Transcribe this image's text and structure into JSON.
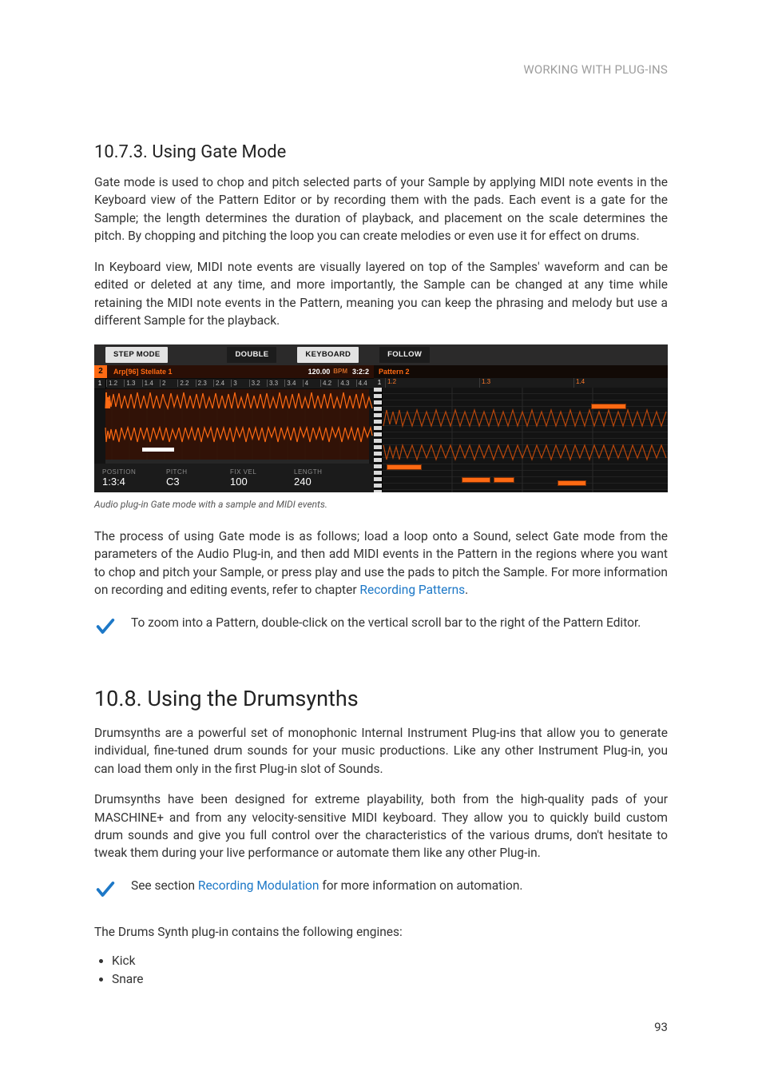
{
  "header": {
    "running_title": "WORKING WITH PLUG-INS"
  },
  "section1": {
    "heading": "10.7.3. Using Gate Mode",
    "p1": "Gate mode is used to chop and pitch selected parts of your Sample by applying MIDI note events in the Keyboard view of the Pattern Editor or by recording them with the pads. Each event is a gate for the Sample; the length determines the duration of playback, and placement on the scale determines the pitch. By chopping and pitching the loop you can create melodies or even use it for effect on drums.",
    "p2": "In Keyboard view, MIDI note events are visually layered on top of the Samples' waveform and can be edited or deleted at any time, and more importantly, the Sample can be changed at any time while retaining the MIDI note events in the Pattern, meaning you can keep the phrasing and melody but use a different Sample for the playback."
  },
  "figure": {
    "toolbar": {
      "step_mode": "STEP MODE",
      "double": "DOUBLE",
      "keyboard": "KEYBOARD",
      "follow": "FOLLOW"
    },
    "left": {
      "sound_index": "2",
      "sound_name": "Arp[96] Stellate 1",
      "bpm_value": "120.00",
      "bpm_unit": "BPM",
      "timesig": "3:2:2",
      "ruler_start_num": "1",
      "ruler_ticks": [
        "1.2",
        "1.3",
        "1.4",
        "2",
        "2.2",
        "2.3",
        "2.4",
        "3",
        "3.2",
        "3.3",
        "3.4",
        "4",
        "4.2",
        "4.3",
        "4.4"
      ],
      "params": {
        "position": {
          "label": "POSITION",
          "value": "1:3:4"
        },
        "pitch": {
          "label": "PITCH",
          "value": "C3"
        },
        "fixvel": {
          "label": "FIX VEL",
          "value": "100"
        },
        "length": {
          "label": "LENGTH",
          "value": "240"
        }
      }
    },
    "right": {
      "pattern_label": "Pattern 2",
      "ruler_start_num": "1",
      "ruler_ticks": [
        "1.2",
        "1.3",
        "1.4"
      ]
    },
    "caption": "Audio plug-in Gate mode with a sample and MIDI events."
  },
  "section1b": {
    "p3_pre": "The process of using Gate mode is as follows; load a loop onto a Sound, select Gate mode from the parameters of the Audio Plug-in, and then add MIDI events in the Pattern in the regions where you want to chop and pitch your Sample, or press play and use the pads to pitch the Sample. For more information on recording and editing events, refer to chapter ",
    "p3_link": "Recording Patterns",
    "p3_post": ".",
    "tip": "To zoom into a Pattern, double-click on the vertical scroll bar to the right of the Pattern Editor."
  },
  "section2": {
    "heading": "10.8. Using the Drumsynths",
    "p1": "Drumsynths are a powerful set of monophonic Internal Instrument Plug-ins that allow you to generate individual, fine-tuned drum sounds for your music productions. Like any other Instrument Plug-in, you can load them only in the first Plug-in slot of Sounds.",
    "p2": "Drumsynths have been designed for extreme playability, both from the high-quality pads of your MASCHINE+ and from any velocity-sensitive MIDI keyboard. They allow you to quickly build custom drum sounds and give you full control over the characteristics of the various drums, don't hesitate to tweak them during your live performance or automate them like any other Plug-in.",
    "tip_pre": "See section ",
    "tip_link": "Recording Modulation",
    "tip_post": " for more information on automation.",
    "engines_intro": "The Drums Synth plug-in contains the following engines:",
    "engines": [
      "Kick",
      "Snare"
    ]
  },
  "page_number": "93"
}
